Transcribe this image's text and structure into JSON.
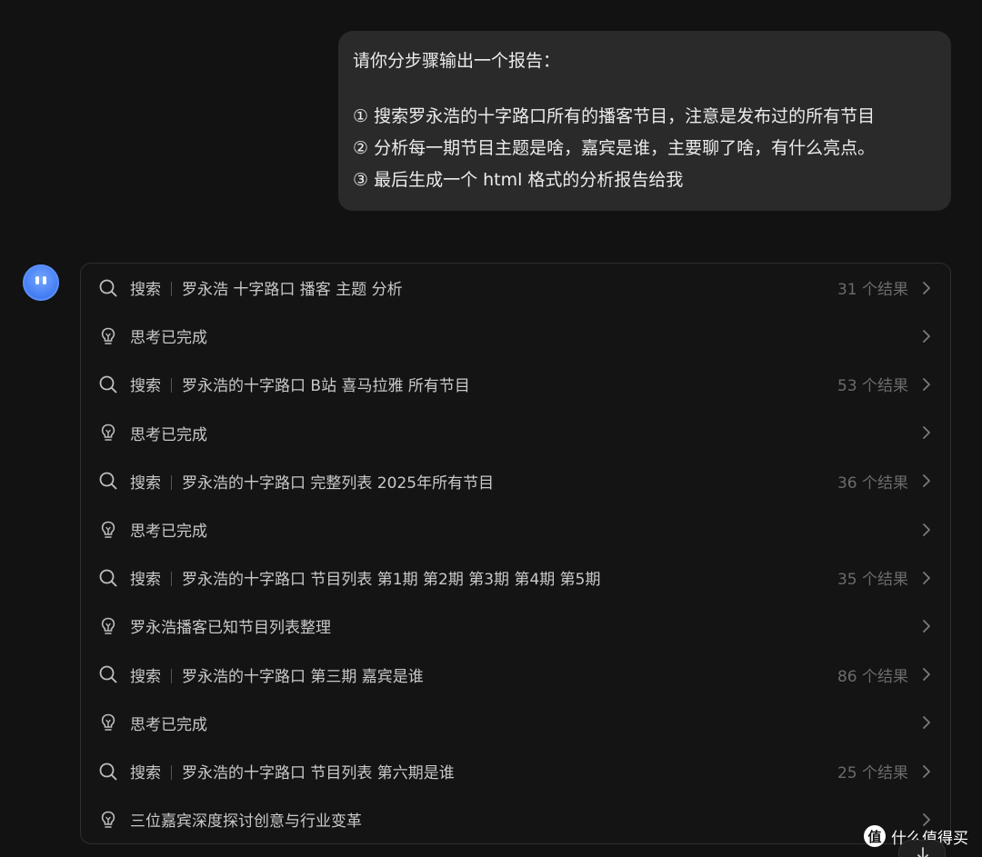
{
  "user_message": {
    "lines": [
      "请你分步骤输出一个报告：",
      "① 搜索罗永浩的十字路口所有的播客节目，注意是发布过的所有节目",
      "② 分析每一期节目主题是啥，嘉宾是谁，主要聊了啥，有什么亮点。",
      "③ 最后生成一个 html 格式的分析报告给我"
    ]
  },
  "assistant": {
    "avatar_icon": "assistant-avatar-icon",
    "steps": [
      {
        "type": "search",
        "label": "搜索",
        "query": "罗永浩 十字路口 播客 主题 分析",
        "count": "31 个结果"
      },
      {
        "type": "think",
        "label": "思考已完成"
      },
      {
        "type": "search",
        "label": "搜索",
        "query": "罗永浩的十字路口 B站 喜马拉雅 所有节目",
        "count": "53 个结果"
      },
      {
        "type": "think",
        "label": "思考已完成"
      },
      {
        "type": "search",
        "label": "搜索",
        "query": "罗永浩的十字路口 完整列表 2025年所有节目",
        "count": "36 个结果"
      },
      {
        "type": "think",
        "label": "思考已完成"
      },
      {
        "type": "search",
        "label": "搜索",
        "query": "罗永浩的十字路口 节目列表 第1期 第2期 第3期 第4期 第5期",
        "count": "35 个结果"
      },
      {
        "type": "think",
        "label": "罗永浩播客已知节目列表整理"
      },
      {
        "type": "search",
        "label": "搜索",
        "query": "罗永浩的十字路口 第三期 嘉宾是谁",
        "count": "86 个结果"
      },
      {
        "type": "think",
        "label": "思考已完成"
      },
      {
        "type": "search",
        "label": "搜索",
        "query": "罗永浩的十字路口 节目列表 第六期是谁",
        "count": "25 个结果"
      },
      {
        "type": "think",
        "label": "三位嘉宾深度探讨创意与行业变革"
      }
    ]
  },
  "watermark": {
    "logo": "值",
    "text": "什么值得买"
  },
  "colors": {
    "background": "#121212",
    "bubble": "#2a2a2a",
    "avatar": "#4a82f5"
  }
}
